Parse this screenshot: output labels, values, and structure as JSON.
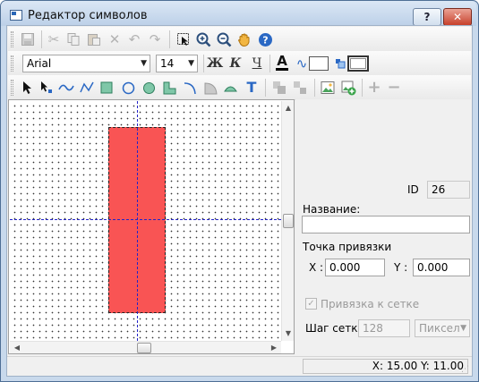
{
  "window": {
    "title": "Редактор символов",
    "help_btn": "?",
    "close_btn": "✕"
  },
  "toolbar1": {
    "icons": [
      "save-icon",
      "cut-icon",
      "copy-icon",
      "paste-icon",
      "delete-icon",
      "undo-icon",
      "redo-icon",
      "select-area-icon",
      "zoom-in-icon",
      "zoom-out-icon",
      "pan-hand-icon",
      "help-icon"
    ]
  },
  "toolbar2": {
    "font_family": "Arial",
    "font_size": "14",
    "bold_label": "Ж",
    "italic_label": "К",
    "underline_label": "Ч",
    "text_color_label": "A"
  },
  "toolbar3": {
    "text_tool_label": "T",
    "add_label": "+",
    "remove_label": "−"
  },
  "colors": {
    "shape_fill": "#f95454",
    "guide_line": "#2323c8"
  },
  "panel": {
    "id_label": "ID",
    "id_value": "26",
    "name_label": "Название:",
    "name_value": "",
    "anchor_label": "Точка привязки",
    "x_label": "X :",
    "x_value": "0.000",
    "y_label": "Y :",
    "y_value": "0.000",
    "snap_label": "Привязка к сетке",
    "snap_checked": "✓",
    "grid_step_label": "Шаг сетки",
    "grid_step_value": "128",
    "grid_unit": "Пиксел"
  },
  "status": {
    "coords": "X: 15.00  Y: 11.00"
  }
}
